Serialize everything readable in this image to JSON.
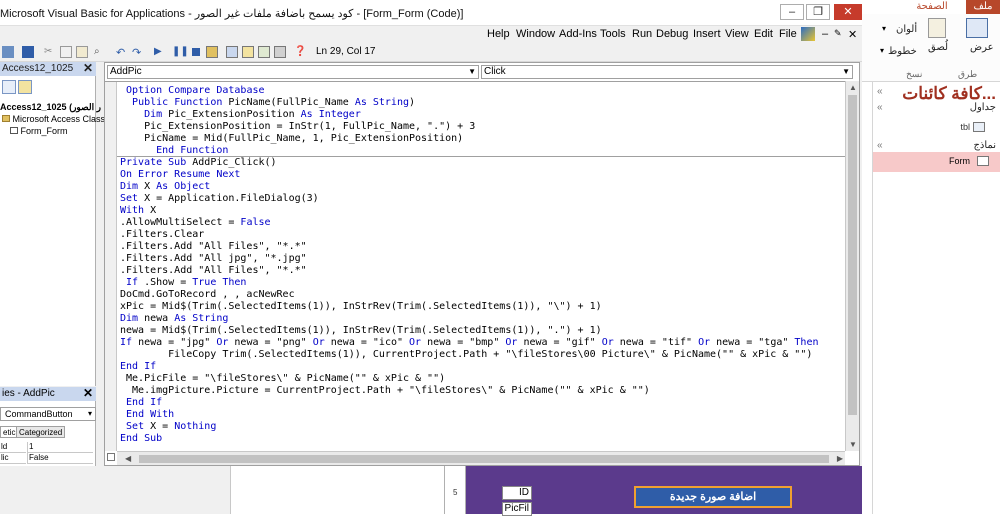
{
  "window": {
    "title": "Microsoft Visual Basic for Applications - كود يسمح باضافة ملفات غير الصور - [Form_Form (Code)]",
    "controls": [
      "–",
      "❐",
      "✕"
    ]
  },
  "menu": [
    "Help",
    "Window",
    "Add-Ins",
    "Tools",
    "Run",
    "Debug",
    "Insert",
    "View",
    "Edit",
    "File"
  ],
  "menu_extras": [
    "✎",
    "–",
    "✕"
  ],
  "toolbar": {
    "position": "Ln 29, Col 17"
  },
  "project": {
    "title": "Access12_1025",
    "items": [
      "Access12_1025 (ر الصور",
      "Microsoft Access Class O",
      "Form_Form"
    ]
  },
  "properties": {
    "title": "ies - AddPic",
    "object": "CommandButton",
    "tabs": [
      "etic",
      "Categorized"
    ],
    "rows": [
      {
        "name": "ld",
        "value": "1"
      },
      {
        "name": "lic",
        "value": "False"
      }
    ]
  },
  "code": {
    "object_combo": "AddPic",
    "proc_combo": "Click",
    "lines": [
      [
        {
          "t": " "
        },
        {
          "t": "Option Compare Database",
          "k": 1
        }
      ],
      [
        {
          "t": "  "
        },
        {
          "t": "Public Function",
          "k": 1
        },
        {
          "t": " PicName(FullPic_Name "
        },
        {
          "t": "As String",
          "k": 1
        },
        {
          "t": ")"
        }
      ],
      [
        {
          "t": "    "
        },
        {
          "t": "Dim",
          "k": 1
        },
        {
          "t": " Pic_ExtensionPosition "
        },
        {
          "t": "As Integer",
          "k": 1
        }
      ],
      [
        {
          "t": "    Pic_ExtensionPosition = InStr(1, FullPic_Name, \".\") + 3"
        }
      ],
      [
        {
          "t": "    PicName = Mid(FullPic_Name, 1, Pic_ExtensionPosition)"
        }
      ],
      [
        {
          "t": "      "
        },
        {
          "t": "End Function",
          "k": 1
        }
      ],
      [
        {
          "t": "Private Sub",
          "k": 1
        },
        {
          "t": " AddPic_Click()"
        }
      ],
      [
        {
          "t": "On Error Resume Next",
          "k": 1
        }
      ],
      [
        {
          "t": "Dim",
          "k": 1
        },
        {
          "t": " X "
        },
        {
          "t": "As Object",
          "k": 1
        }
      ],
      [
        {
          "t": "Set",
          "k": 1
        },
        {
          "t": " X = Application.FileDialog(3)"
        }
      ],
      [
        {
          "t": "With",
          "k": 1
        },
        {
          "t": " X"
        }
      ],
      [
        {
          "t": ".AllowMultiSelect = "
        },
        {
          "t": "False",
          "k": 1
        }
      ],
      [
        {
          "t": ".Filters.Clear"
        }
      ],
      [
        {
          "t": ".Filters.Add \"All Files\", \"*.*\""
        }
      ],
      [
        {
          "t": ".Filters.Add \"All jpg\", \"*.jpg\""
        }
      ],
      [
        {
          "t": ".Filters.Add \"All Files\", \"*.*\""
        }
      ],
      [
        {
          "t": " "
        },
        {
          "t": "If",
          "k": 1
        },
        {
          "t": " .Show = "
        },
        {
          "t": "True Then",
          "k": 1
        }
      ],
      [
        {
          "t": "DoCmd.GoToRecord , , acNewRec"
        }
      ],
      [
        {
          "t": "xPic = Mid$(Trim(.SelectedItems(1)), InStrRev(Trim(.SelectedItems(1)), \"\\\") + 1)"
        }
      ],
      [
        {
          "t": "Dim",
          "k": 1
        },
        {
          "t": " newa "
        },
        {
          "t": "As String",
          "k": 1
        }
      ],
      [
        {
          "t": "newa = Mid$(Trim(.SelectedItems(1)), InStrRev(Trim(.SelectedItems(1)), \".\") + 1)"
        }
      ],
      [
        {
          "t": "If",
          "k": 1
        },
        {
          "t": " newa = \"jpg\" "
        },
        {
          "t": "Or",
          "k": 1
        },
        {
          "t": " newa = \"png\" "
        },
        {
          "t": "Or",
          "k": 1
        },
        {
          "t": " newa = \"ico\" "
        },
        {
          "t": "Or",
          "k": 1
        },
        {
          "t": " newa = \"bmp\" "
        },
        {
          "t": "Or",
          "k": 1
        },
        {
          "t": " newa = \"gif\" "
        },
        {
          "t": "Or",
          "k": 1
        },
        {
          "t": " newa = \"tif\" "
        },
        {
          "t": "Or",
          "k": 1
        },
        {
          "t": " newa = \"tga\" "
        },
        {
          "t": "Then",
          "k": 1
        }
      ],
      [
        {
          "t": "        FileCopy Trim(.SelectedItems(1)), CurrentProject.Path + \"\\fileStores\\00 Picture\\\" & PicName(\"\" & xPic & \"\")"
        }
      ],
      [
        {
          "t": "End If",
          "k": 1
        }
      ],
      [
        {
          "t": " Me.PicFile = \"\\fileStores\\\" & PicName(\"\" & xPic & \"\")"
        }
      ],
      [
        {
          "t": "  Me.imgPicture.Picture = CurrentProject.Path + \"\\fileStores\\\" & PicName(\"\" & xPic & \"\")"
        }
      ],
      [
        {
          "t": " "
        },
        {
          "t": "End If",
          "k": 1
        }
      ],
      [
        {
          "t": " "
        },
        {
          "t": "End With",
          "k": 1
        }
      ],
      [
        {
          "t": " "
        },
        {
          "t": "Set",
          "k": 1
        },
        {
          "t": " X = "
        },
        {
          "t": "Nothing",
          "k": 1
        }
      ],
      [
        {
          "t": "End Sub",
          "k": 1
        }
      ]
    ]
  },
  "access": {
    "tabs": [
      "ملف",
      "الصفحة الرئيسية"
    ],
    "ribbon": {
      "view_label": "عرض",
      "views_group": "طرق عرض",
      "paste_label": "لُصق",
      "clipboard_group": "نسخ",
      "colors_label": "ألوان",
      "lines_label": "خطوط"
    },
    "nav": {
      "title": "كافة كائنات...",
      "tables_label": "جداول",
      "table_item": "tbl",
      "forms_label": "نماذج",
      "form_item": "Form"
    }
  },
  "form_design": {
    "button_label": "اضافة صورة جديدة",
    "field_id": "ID",
    "field_picfile": "PicFil",
    "ruler_label": "5"
  }
}
